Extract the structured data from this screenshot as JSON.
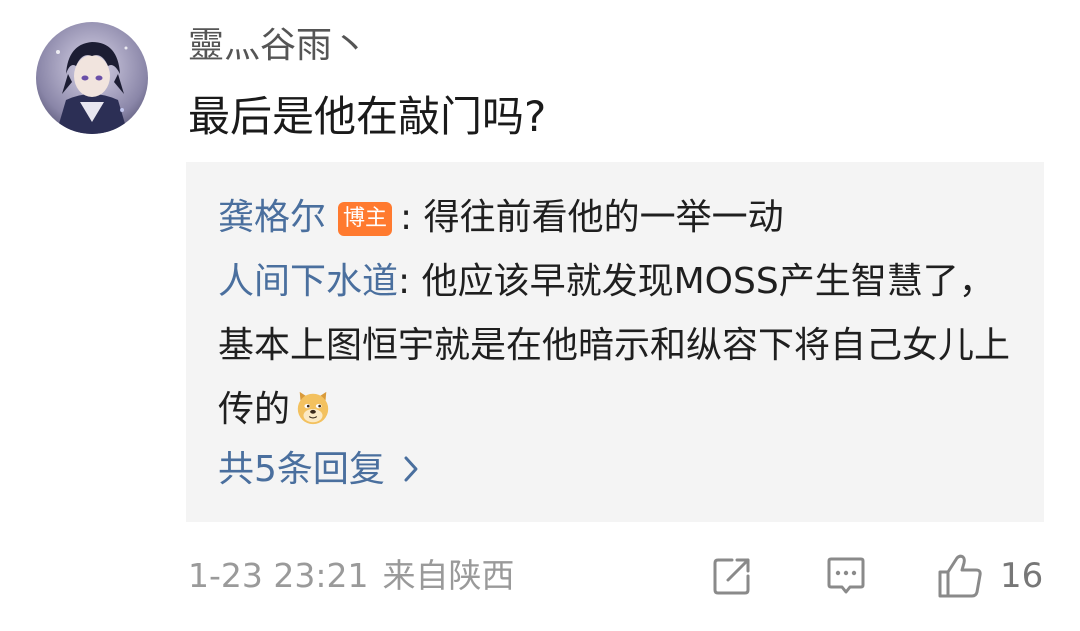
{
  "comment": {
    "username": "靈灬谷雨丶",
    "text": "最后是他在敲门吗?",
    "avatar_icon": "anime-avatar"
  },
  "replies": [
    {
      "author": "龚格尔",
      "badge": "博主",
      "separator": ": ",
      "text": "得往前看他的一举一动"
    },
    {
      "author": "人间下水道",
      "separator": ": ",
      "text": "他应该早就发现MOSS产生智慧了，基本上图恒宇就是在他暗示和纵容下将自己女儿上传的",
      "emoji": "doge-emoji"
    }
  ],
  "more_replies": {
    "label": "共5条回复",
    "icon": "chevron-right-icon"
  },
  "meta": {
    "timestamp": "1-23 23:21",
    "location": "来自陕西"
  },
  "actions": {
    "share_icon": "share-icon",
    "comment_icon": "comment-icon",
    "like_icon": "thumbs-up-icon",
    "like_count": "16"
  },
  "colors": {
    "link": "#4a6f9e",
    "badge": "#ff7a2f",
    "reply_bg": "#f4f4f4",
    "meta_text": "#9a9a9a"
  }
}
